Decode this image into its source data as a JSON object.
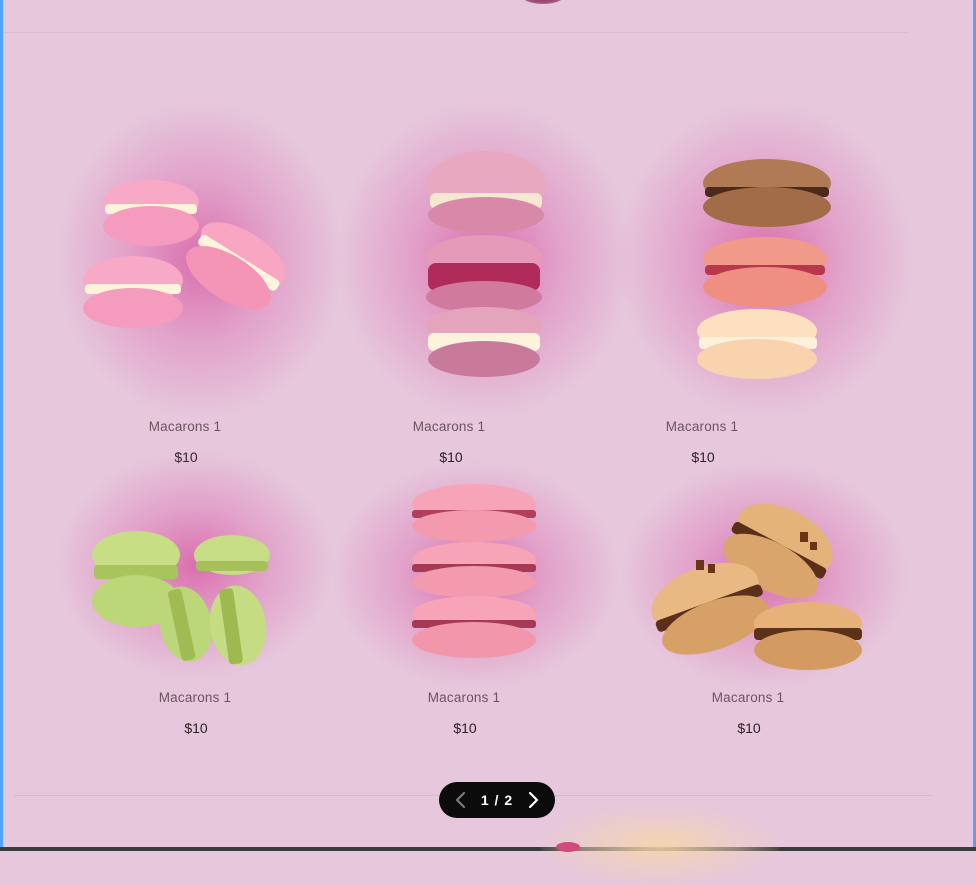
{
  "products": [
    {
      "name": "Macarons 1",
      "price": "$10",
      "icon": "pink-macarons-image"
    },
    {
      "name": "Macarons 1",
      "price": "$10",
      "icon": "bitten-macaron-stack-image"
    },
    {
      "name": "Macarons 1",
      "price": "$10",
      "icon": "chocolate-raspberry-vanilla-stack-image"
    },
    {
      "name": "Macarons 1",
      "price": "$10",
      "icon": "pistachio-macarons-image"
    },
    {
      "name": "Macarons 1",
      "price": "$10",
      "icon": "strawberry-macaron-stack-image"
    },
    {
      "name": "Macarons 1",
      "price": "$10",
      "icon": "caramel-macarons-image"
    }
  ],
  "pagination": {
    "label": "1 / 2",
    "prev_icon": "chevron-left-icon",
    "next_icon": "chevron-right-icon"
  },
  "colors": {
    "background": "#e6c7dc",
    "glow": "#d860a6",
    "pager": "#0b0b0b",
    "frame": "#4da3ff"
  }
}
